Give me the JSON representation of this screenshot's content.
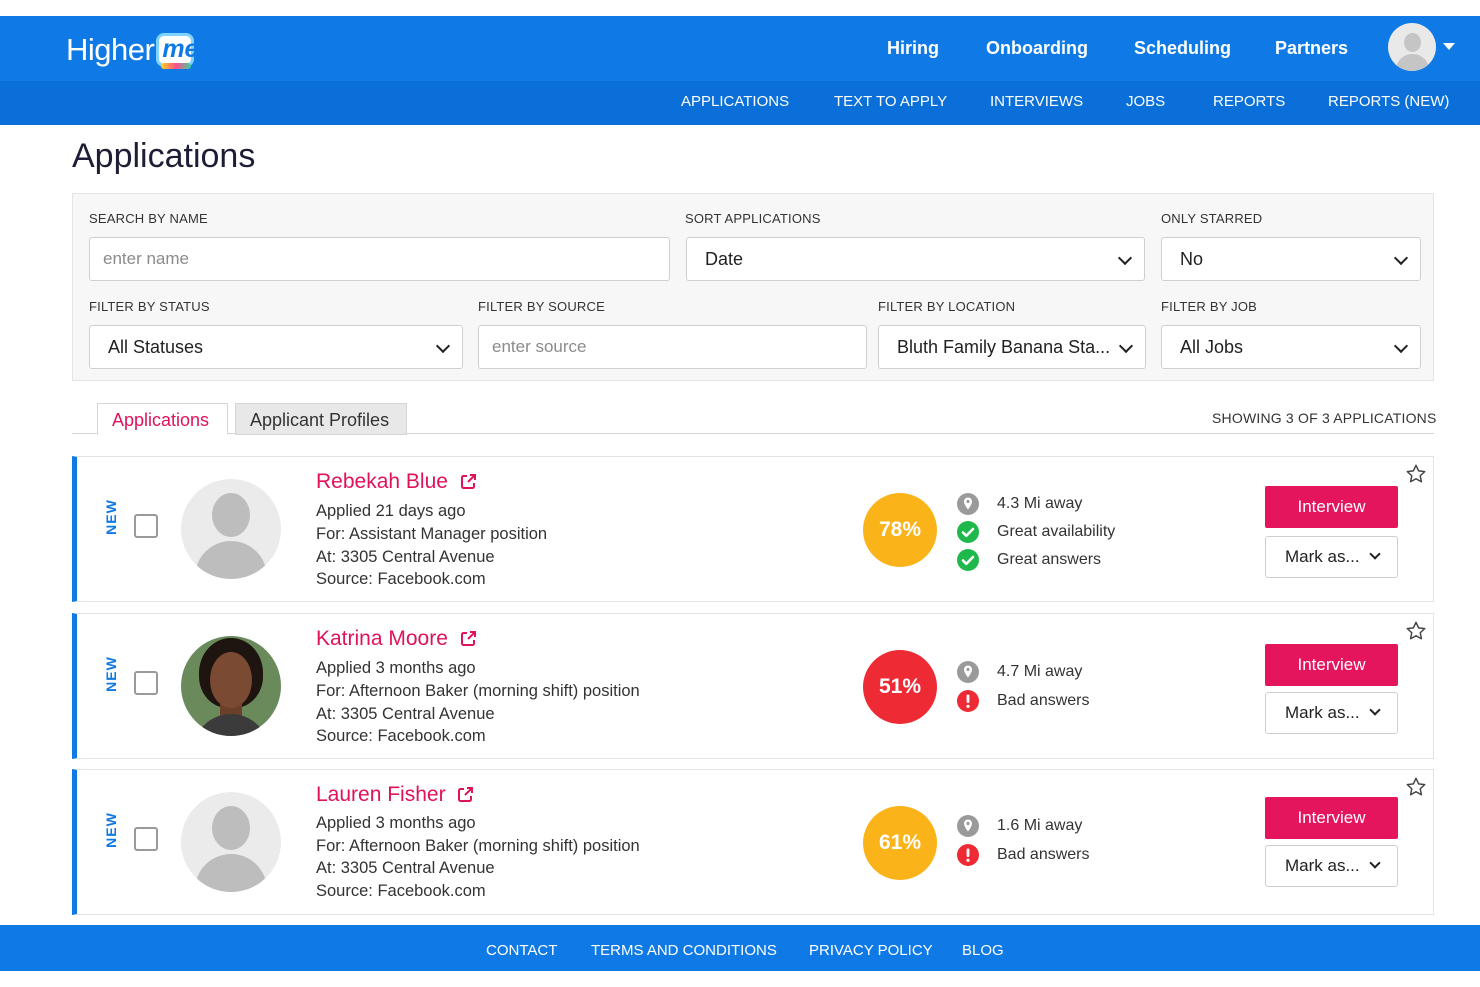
{
  "brand": {
    "logo_text": "Higher",
    "logo_badge": "me",
    "accent": "#0f7ae5",
    "pink": "#e0125b"
  },
  "main_nav": [
    "Hiring",
    "Onboarding",
    "Scheduling",
    "Partners"
  ],
  "sub_nav": [
    "APPLICATIONS",
    "TEXT TO APPLY",
    "INTERVIEWS",
    "JOBS",
    "REPORTS",
    "REPORTS (NEW)"
  ],
  "page_title": "Applications",
  "filters": {
    "search_label": "SEARCH BY NAME",
    "search_placeholder": "enter name",
    "sort_label": "SORT APPLICATIONS",
    "sort_value": "Date",
    "starred_label": "ONLY STARRED",
    "starred_value": "No",
    "status_label": "FILTER BY STATUS",
    "status_value": "All Statuses",
    "source_label": "FILTER BY SOURCE",
    "source_placeholder": "enter source",
    "location_label": "FILTER BY LOCATION",
    "location_value": "Bluth Family Banana Sta...",
    "job_label": "FILTER BY JOB",
    "job_value": "All Jobs"
  },
  "tabs": [
    "Applications",
    "Applicant Profiles"
  ],
  "showing": "SHOWING 3 OF 3 APPLICATIONS",
  "applications": [
    {
      "tag": "NEW",
      "name": "Rebekah Blue",
      "applied": "Applied 21 days ago",
      "position": "For: Assistant Manager position",
      "at": "At: 3305 Central Avenue",
      "source": "Source: Facebook.com",
      "score": "78%",
      "score_color": "#fbb31a",
      "indicators": [
        "4.3 Mi away",
        "Great availability",
        "Great answers"
      ],
      "interview_label": "Interview",
      "mark_label": "Mark as..."
    },
    {
      "tag": "NEW",
      "name": "Katrina Moore",
      "applied": "Applied 3 months ago",
      "position": "For: Afternoon Baker (morning shift) position",
      "at": "At: 3305 Central Avenue",
      "source": "Source: Facebook.com",
      "score": "51%",
      "score_color": "#ee2b35",
      "indicators": [
        "4.7 Mi away",
        "Bad answers"
      ],
      "interview_label": "Interview",
      "mark_label": "Mark as..."
    },
    {
      "tag": "NEW",
      "name": "Lauren Fisher",
      "applied": "Applied 3 months ago",
      "position": "For: Afternoon Baker (morning shift) position",
      "at": "At: 3305 Central Avenue",
      "source": "Source: Facebook.com",
      "score": "61%",
      "score_color": "#fbb31a",
      "indicators": [
        "1.6 Mi away",
        "Bad answers"
      ],
      "interview_label": "Interview",
      "mark_label": "Mark as..."
    }
  ],
  "footer": [
    "CONTACT",
    "TERMS AND CONDITIONS",
    "PRIVACY POLICY",
    "BLOG"
  ]
}
